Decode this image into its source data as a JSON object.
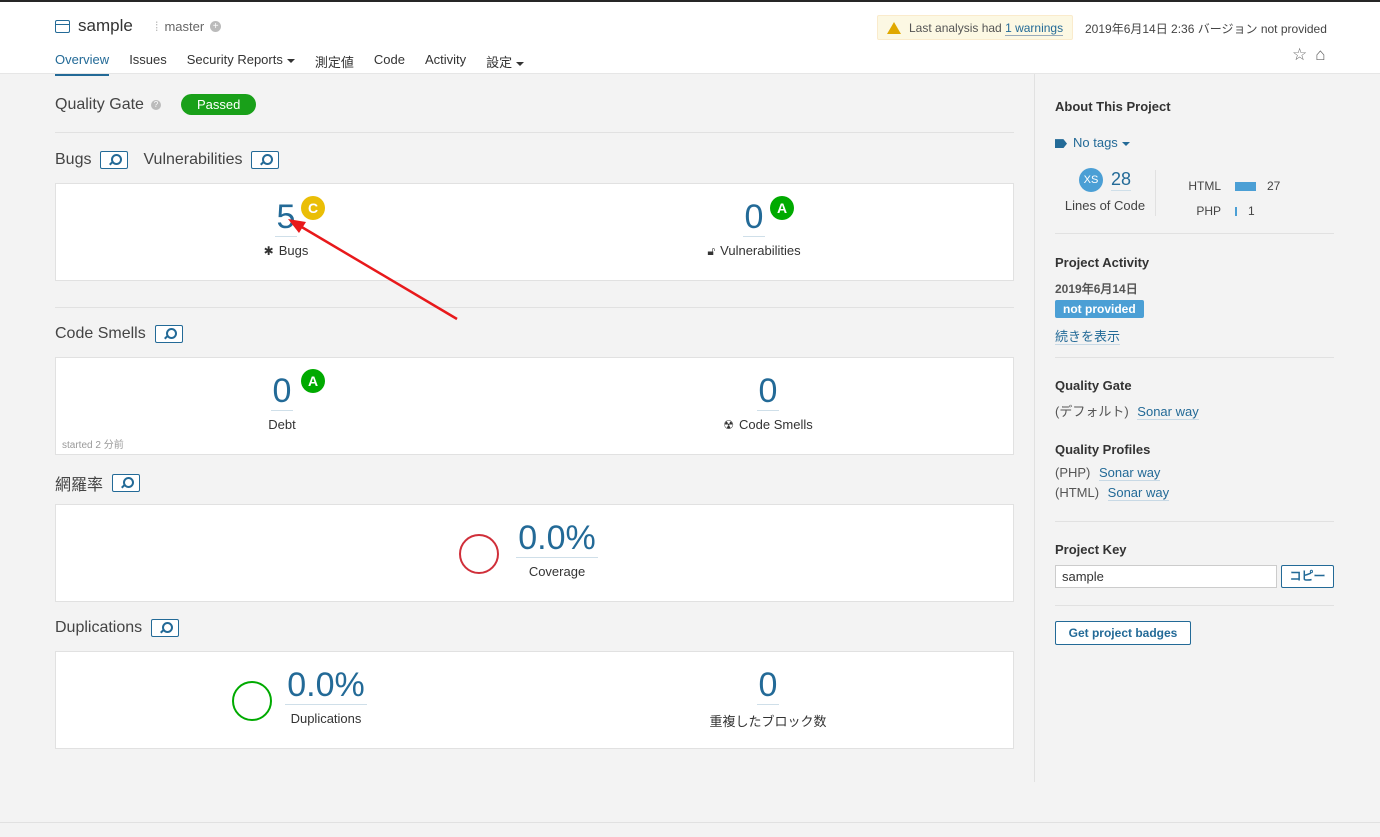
{
  "header": {
    "project_name": "sample",
    "branch": "master",
    "warning_prefix": "Last analysis had ",
    "warning_link": "1 warnings",
    "meta": "2019年6月14日 2:36  バージョン not provided",
    "nav": [
      "Overview",
      "Issues",
      "Security Reports",
      "測定値",
      "Code",
      "Activity",
      "設定"
    ]
  },
  "quality_gate": {
    "title": "Quality Gate",
    "status": "Passed"
  },
  "bugs_vulns": {
    "title_bugs": "Bugs",
    "title_vulns": "Vulnerabilities",
    "bugs_value": "5",
    "bugs_rating": "C",
    "bugs_label": "Bugs",
    "vulns_value": "0",
    "vulns_rating": "A",
    "vulns_label": "Vulnerabilities"
  },
  "code_smells": {
    "title": "Code Smells",
    "debt_value": "0",
    "debt_rating": "A",
    "debt_label": "Debt",
    "smells_value": "0",
    "smells_label": "Code Smells",
    "started": "started 2 分前"
  },
  "coverage": {
    "title": "網羅率",
    "value": "0.0%",
    "label": "Coverage"
  },
  "duplications": {
    "title": "Duplications",
    "value": "0.0%",
    "label": "Duplications",
    "blocks_value": "0",
    "blocks_label": "重複したブロック数"
  },
  "sidebar": {
    "about_title": "About This Project",
    "tags": "No tags",
    "loc_size": "XS",
    "loc_value": "28",
    "loc_label": "Lines of Code",
    "languages": [
      {
        "name": "HTML",
        "count": "27"
      },
      {
        "name": "PHP",
        "count": "1"
      }
    ],
    "activity_title": "Project Activity",
    "activity_date": "2019年6月14日",
    "activity_badge": "not provided",
    "activity_more": "続きを表示",
    "qg_title": "Quality Gate",
    "qg_prefix": "(デフォルト)",
    "qg_link": "Sonar way",
    "profiles_title": "Quality Profiles",
    "profiles": [
      {
        "lang": "(PHP)",
        "name": "Sonar way"
      },
      {
        "lang": "(HTML)",
        "name": "Sonar way"
      }
    ],
    "key_title": "Project Key",
    "key_value": "sample",
    "copy_label": "コピー",
    "badges_label": "Get project badges"
  },
  "colors": {
    "accent": "#236a97",
    "passed": "#19a019",
    "rating_c": "#eabe06",
    "rating_a": "#00aa00",
    "coverage_ring": "#d02f3a",
    "dup_ring": "#00aa00",
    "annotation_arrow": "#e8191b"
  }
}
